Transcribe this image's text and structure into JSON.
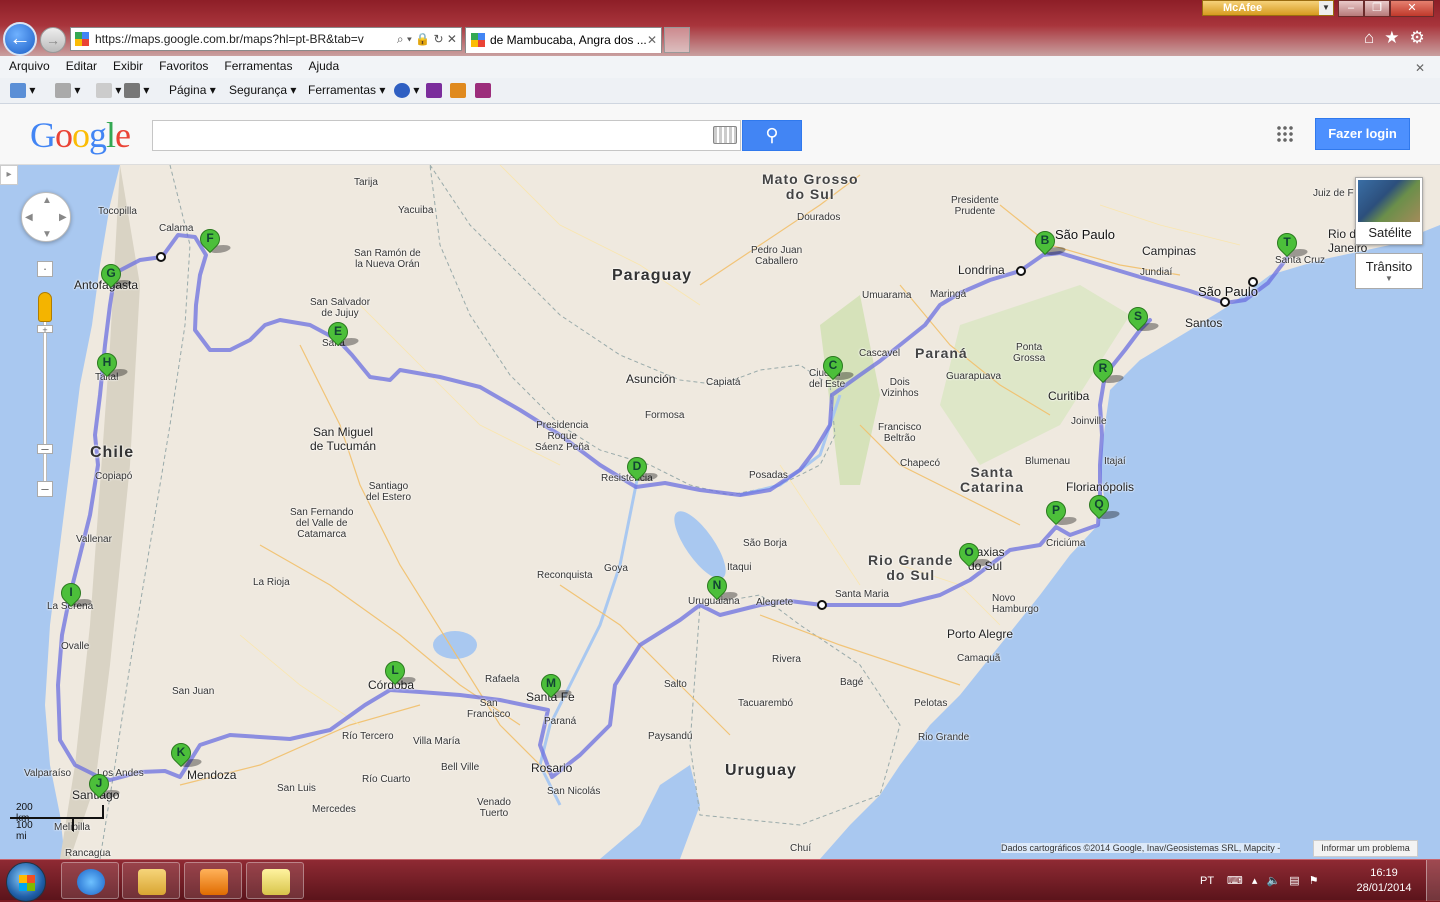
{
  "browser": {
    "url": "https://maps.google.com.br/maps?hl=pt-BR&tab=v",
    "address_tools": "⌕ ▾ 🔒 ↻ ✕",
    "tab_title": "de Mambucaba, Angra dos ...",
    "mcafee": "McAfee"
  },
  "menu": {
    "items": [
      "Arquivo",
      "Editar",
      "Exibir",
      "Favoritos",
      "Ferramentas",
      "Ajuda"
    ]
  },
  "command_bar": {
    "pagina": "Página ▾",
    "seguranca": "Segurança ▾",
    "ferramentas": "Ferramentas ▾"
  },
  "google": {
    "search_value": "",
    "login": "Fazer login"
  },
  "map": {
    "satellite_label": "Satélite",
    "traffic_label": "Trânsito",
    "scale_km": "200 km",
    "scale_mi": "100 mi",
    "attribution": "Dados cartográficos ©2014 Google, Inav/Geosistemas SRL, Mapcity -",
    "report_problem": "Informar um problema",
    "countries": [
      "Paraguay",
      "Chile",
      "Uruguay"
    ],
    "states": {
      "mato_grosso": "Mato Grosso\ndo Sul",
      "parana": "Paraná",
      "santa_catarina": "Santa\nCatarina",
      "rio_grande": "Rio Grande\ndo Sul"
    },
    "cities": {
      "sao_paulo": "São Paulo",
      "sao_paulo_b": "São Paulo",
      "campinas": "Campinas",
      "santos": "Santos",
      "londrina": "Londrina",
      "curitiba": "Curitiba",
      "asuncion": "Asunción",
      "resistencia": "Resistencia",
      "posadas": "Posadas",
      "florianopolis": "Florianópolis",
      "porto_alegre": "Porto Alegre",
      "caxias": "Caxias\ndo Sul",
      "santa_maria": "Santa Maria",
      "uruguaiana": "Uruguaiana",
      "santa_fe": "Santa Fe",
      "rosario": "Rosario",
      "cordoba": "Córdoba",
      "mendoza": "Mendoza",
      "santiago": "Santiago",
      "valparaiso": "Valparaíso",
      "rancagua": "Rancagua",
      "la_serena": "La Serena",
      "copiapo": "Copiapó",
      "taltal": "Taltal",
      "antofagasta": "Antofagasta",
      "tocopilla": "Tocopilla",
      "calama": "Calama",
      "salta": "Salta",
      "san_salvador": "San Salvador\nde Jujuy",
      "tucuman": "San Miguel\nde Tucumán",
      "santiago_estero": "Santiago\ndel Estero",
      "san_juan": "San Juan",
      "la_rioja": "La Rioja",
      "catamarca": "San Fernando\ndel Valle de\nCatamarca",
      "ciudad_este": "Ciudad\ndel Este",
      "cascavel": "Cascavel",
      "maringa": "Maringá",
      "joinville": "Joinville",
      "blumenau": "Blumenau",
      "itajai": "Itajaí",
      "criciuma": "Criciúma",
      "novo_hamburgo": "Novo\nHamburgo",
      "pelotas": "Pelotas",
      "rio_grande": "Rio Grande",
      "bage": "Bagé",
      "rivera": "Rivera",
      "salto": "Salto",
      "paysandu": "Paysandú",
      "tacuarembo": "Tacuarembó",
      "parana_city": "Paraná",
      "rio_cuarto": "Río Cuarto",
      "rio_tercero": "Río Tercero",
      "villa_maria": "Villa María",
      "bell_ville": "Bell Ville",
      "san_nicolas": "San Nicolás",
      "venado_tuerto": "Venado\nTuerto",
      "mercedes": "Mercedes",
      "san_luis": "San Luis",
      "rafaela": "Rafaela",
      "san_francisco": "San\nFrancisco",
      "reconquista": "Reconquista",
      "goya": "Goya",
      "formosa": "Formosa",
      "presidencia": "Presidencia\nRoque\nSáenz Peña",
      "tarija": "Tarija",
      "yacuiba": "Yacuiba",
      "oran": "San Ramón de\nla Nueva Orán",
      "dourados": "Dourados",
      "ponta_pora": "Pedro Juan\nCaballero",
      "presidente": "Presidente\nPrudente",
      "jundiai": "Jundiaí",
      "juiz": "Juiz de F",
      "rio": "Rio de\nJaneiro",
      "santa_cruz": "Santa Cruz",
      "ponta_grossa": "Ponta\nGrossa",
      "guarapuava": "Guarapuava",
      "umuarama": "Umuarama",
      "dois_vizinhos": "Dois\nVizinhos",
      "francisco_beltrao": "Francisco\nBeltrão",
      "chapeco": "Chapecó",
      "capiata": "Capiatá",
      "vallenar": "Vallenar",
      "ovalle": "Ovalle",
      "melipilla": "Melipilla",
      "los_andes": "Los Andes",
      "itaqui": "Itaqui",
      "sao_borja": "São Borja",
      "alegrete": "Alegrete",
      "camaqua": "Camaquã",
      "chui": "Chuí"
    },
    "markers": [
      {
        "letter": "B"
      },
      {
        "letter": "C"
      },
      {
        "letter": "D"
      },
      {
        "letter": "E"
      },
      {
        "letter": "F"
      },
      {
        "letter": "G"
      },
      {
        "letter": "H"
      },
      {
        "letter": "I"
      },
      {
        "letter": "J"
      },
      {
        "letter": "K"
      },
      {
        "letter": "L"
      },
      {
        "letter": "M"
      },
      {
        "letter": "N"
      },
      {
        "letter": "O"
      },
      {
        "letter": "P"
      },
      {
        "letter": "Q"
      },
      {
        "letter": "R"
      },
      {
        "letter": "S"
      },
      {
        "letter": "T"
      }
    ]
  },
  "taskbar": {
    "lang": "PT",
    "time": "16:19",
    "date": "28/01/2014"
  }
}
